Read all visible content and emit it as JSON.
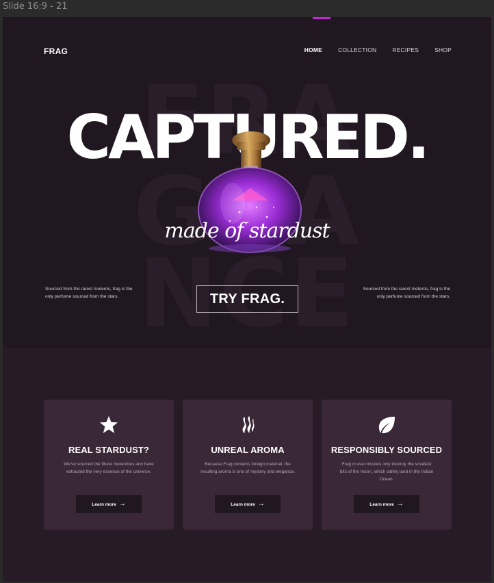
{
  "window": {
    "title": "Slide 16:9 - 21"
  },
  "header": {
    "logo": "FRAG",
    "nav": [
      {
        "label": "HOME",
        "active": true
      },
      {
        "label": "COLLECTION",
        "active": false
      },
      {
        "label": "RECIPES",
        "active": false
      },
      {
        "label": "SHOP",
        "active": false
      }
    ]
  },
  "hero": {
    "background_word": [
      "FRA",
      "GRA",
      "NCE"
    ],
    "headline": "CAPTURED.",
    "tagline": "made of stardust",
    "side_left": "Sourced from the rarest meteros, frag is the only perfume sourced from the stars.",
    "side_right": "Sourced from the rarest meteros, frag is the only perfume sourced from the stars.",
    "cta": "TRY FRAG."
  },
  "features": [
    {
      "icon": "star-icon",
      "title": "REAL STARDUST?",
      "text": "We've sourced the finest meteorites and have extracted the very essence of the universe.",
      "button": "Learn more",
      "arrow": "→"
    },
    {
      "icon": "flame-icon",
      "title": "UNREAL AROMA",
      "text": "Because Frag contains foreign material, the resulting aroma is one of mystery and elegance.",
      "button": "Learn more",
      "arrow": "→"
    },
    {
      "icon": "leaf-icon",
      "title": "RESPONSIBLY SOURCED",
      "text": "Frag cruise missiles only destroy the smallest bits of the moon, which safely land in the Indian Ocean.",
      "button": "Learn more",
      "arrow": "→"
    }
  ],
  "colors": {
    "background": "#211720",
    "features_background": "#271b27",
    "card": "#3a2838",
    "accent": "#c126d6",
    "text": "#ffffff"
  }
}
